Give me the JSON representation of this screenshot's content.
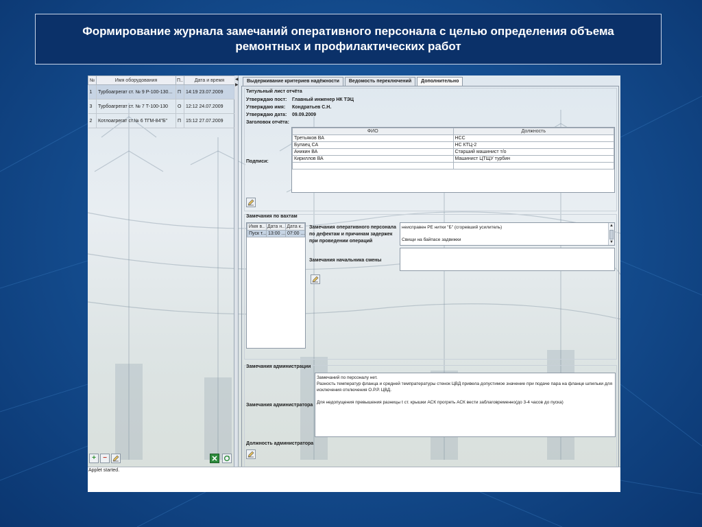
{
  "title": "Формирование журнала замечаний оперативного персонала с целью определения объема ремонтных и профилактических работ",
  "colors": {
    "background": "#154f92",
    "title_box": "#0b3169",
    "title_text": "#ffffff",
    "applet": "#ffffff"
  },
  "equipment_list": {
    "headers": [
      "№",
      "Имя оборудования",
      "П..",
      "Дата и время"
    ],
    "rows": [
      {
        "num": "1",
        "name": "Турбоагрегат ст. № 9 Р-100-130...",
        "p": "П",
        "datetime": "14:19 23.07.2009",
        "selected": true
      },
      {
        "num": "3",
        "name": "Турбоагрегат ст. № 7 Т-100-130",
        "p": "О",
        "datetime": "12:12 24.07.2009",
        "selected": false
      },
      {
        "num": "2",
        "name": "Котлоагрегат ст.№ 6 ТГМ-84\"Б\"",
        "p": "П",
        "datetime": "15:12 27.07.2009",
        "selected": false
      }
    ],
    "buttons": {
      "add": "plus-icon",
      "remove": "minus-icon",
      "edit": "edit-icon",
      "export": "excel-icon",
      "refresh": "refresh-icon"
    }
  },
  "tabs": [
    "Выдерживание критериев надёжности",
    "Ведомость переключений",
    "Дополнительно"
  ],
  "active_tab": "Дополнительно",
  "title_page": {
    "header": "Титульный лист отчёта",
    "fields": [
      {
        "label": "Утверждаю пост:",
        "value": "Главный инженер НК ТЭЦ"
      },
      {
        "label": "Утверждаю имя:",
        "value": "Кондратьев С.Н."
      },
      {
        "label": "Утверждаю дата:",
        "value": "09.09.2009"
      },
      {
        "label": "Заголовок отчёта:",
        "value": ""
      }
    ],
    "signatures_label": "Подписи:",
    "signatures_headers": [
      "ФИО",
      "Должность"
    ],
    "signatures": [
      [
        "Третьяков ВА",
        "НСС"
      ],
      [
        "Булаец СА",
        "НС КТЦ-2"
      ],
      [
        "Аникин ВА",
        "Старший машинист т/о"
      ],
      [
        "Кириллов ВА",
        "Машинист ЦТЩУ турбин"
      ]
    ]
  },
  "shift_remarks": {
    "header": "Замечания по вахтам",
    "table_headers": [
      "Имя в..",
      "Дата н..",
      "Дата к.."
    ],
    "table_rows": [
      [
        "Пуск т...",
        "13:00 ...",
        "07:00 ..."
      ]
    ],
    "personnel_label": "Замечания оперативного персонала по дефектам и причинам задержек при проведении операций",
    "personnel_text": "неисправен РЕ нитки \"Б\" (сгоревший усилитель)\n\nСвищи на байпасе задвижки",
    "chief_label": "Замечания начальника смены",
    "chief_text": ""
  },
  "admin_remarks": {
    "header": "Замечания администрации",
    "label": "Замечания администратора",
    "text": "Замечаний по персоналу нет.\nРазность температур фланца и средней темпратературы стенок ЦВД привела допустимое значение при подаче пара на фланце шпильки для исключения отключения О.Р.Р. ЦВД.\n\nДля недопущения превышения разницы t ст. крышки АСК прогреть АСК вести заблаговременно(до 3-4 часов до пуска)",
    "position_label": "Должность администратора"
  },
  "status_text": "Applet started."
}
